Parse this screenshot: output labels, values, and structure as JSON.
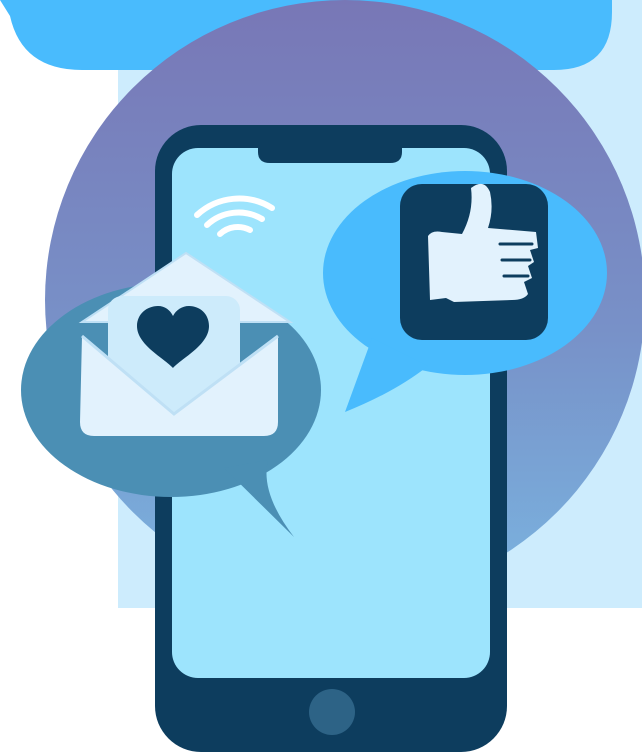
{
  "illustration": {
    "icons": [
      "wifi-icon",
      "thumbs-up-icon",
      "heart-icon",
      "envelope-icon",
      "home-button-icon"
    ],
    "colors": {
      "panel_light": "#cdecfd",
      "tab_blue": "#49bbfd",
      "circle_top": "#7877b6",
      "circle_bottom": "#7ab4e0",
      "phone_body": "#0d3d5e",
      "phone_screen": "#9de4fd",
      "bubble_right": "#49bbfd",
      "bubble_left": "#4b8fb4",
      "envelope": "#e2f2fd",
      "icon_dark": "#0d3d5e"
    }
  }
}
